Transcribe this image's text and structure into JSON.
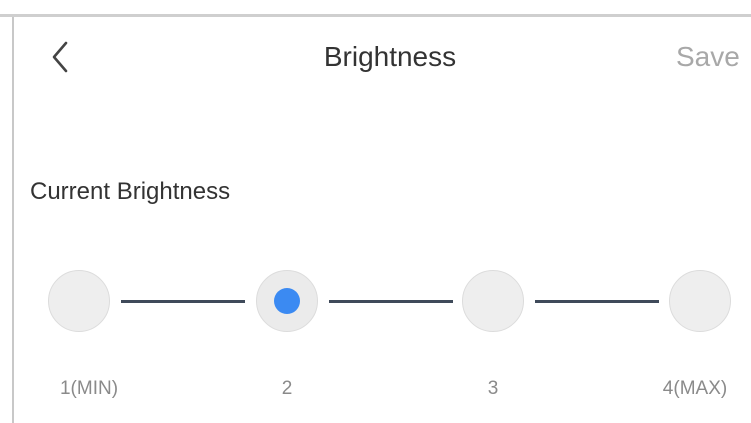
{
  "header": {
    "back_icon": "chevron-left-icon",
    "title": "Brightness",
    "save_label": "Save"
  },
  "section": {
    "label": "Current Brightness"
  },
  "brightness": {
    "selected": 2,
    "levels": [
      {
        "label": "1(MIN)",
        "value": 1
      },
      {
        "label": "2",
        "value": 2
      },
      {
        "label": "3",
        "value": 3
      },
      {
        "label": "4(MAX)",
        "value": 4
      }
    ]
  },
  "colors": {
    "accent": "#3b8af2",
    "connector": "#3f4a5a",
    "save_disabled": "#a8a8a8"
  }
}
